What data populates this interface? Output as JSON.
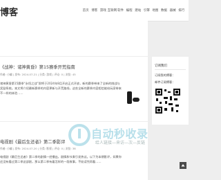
{
  "header": {
    "logo_text": "博客",
    "nav": [
      "首页",
      "博客",
      "游戏",
      "互联网",
      "软件",
      "编程",
      "建站",
      "引擎",
      "地图",
      "数据",
      "器械",
      "排行"
    ]
  },
  "posts": [
    {
      "title": "《战神：诸神黄昏》第15赛季开荒指南",
      "meta": "作者: 小编 | 发布: 2024-07-21 | 分类: 游戏 | 评论: 0 | 浏览: 45",
      "excerpt": "诸神黄昏第15赛季“永恒之战”即将于2024年8月开启正式开放，新的赛季带来了全新的挑战与奖励系统。本文将介绍最新赛季的内容更新与开荒路线，这些全新的赛季内容相信能给玩家带来不一样的体验……"
    },
    {
      "title": "电视剧《最后生还者》第二季影评",
      "meta": "作者: 小编 | 发布: 2024-07-20 | 分类: 影视 | 评论: 0 | 浏览: 38",
      "excerpt": "电视剧《最后生还者》第二季的剧情一经播出，剧情和节奏引发热议。以下为本期影评，如果你还没有看过第二季这部剧，那么第二季有着怎样的一段故事，不妨读完再看……"
    }
  ],
  "sidebar": {
    "title": "订阅我们",
    "items": [
      "订阅我的博客：",
      "邮件订阅博客："
    ]
  },
  "watermark": {
    "text": "自动秒收录",
    "sub": "给人链接—来访—次—反链"
  }
}
